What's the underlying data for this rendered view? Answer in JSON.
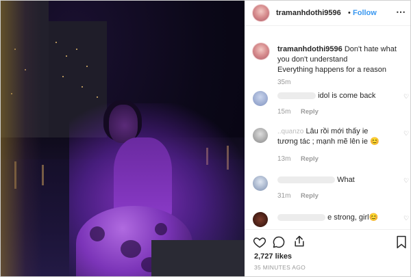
{
  "post": {
    "username": "tramanhdothi9596",
    "follow_label": "Follow",
    "caption_line1": "Don't hate what",
    "caption_line2": "you don't understand",
    "caption_line3": "Everything happens for a reason",
    "caption_age": "35m",
    "likes": "2,727 likes",
    "timestamp": "35 MINUTES AGO"
  },
  "comments": [
    {
      "text": "idol is come back",
      "age": "15m",
      "reply": "Reply"
    },
    {
      "prefix": "..quanzo",
      "text_line1": "Lâu rồi mới thấy ie",
      "text_line2": "tương tác ; mạnh mẽ lên ie 😊",
      "age": "13m",
      "reply": "Reply"
    },
    {
      "text": "What",
      "age": "31m",
      "reply": "Reply"
    },
    {
      "text": "e strong, girl😊"
    }
  ],
  "colors": {
    "follow": "#3897f0",
    "text": "#262626",
    "muted": "#999999"
  },
  "icons": [
    "heart-icon",
    "comment-icon",
    "share-icon",
    "bookmark-icon",
    "more-icon"
  ]
}
